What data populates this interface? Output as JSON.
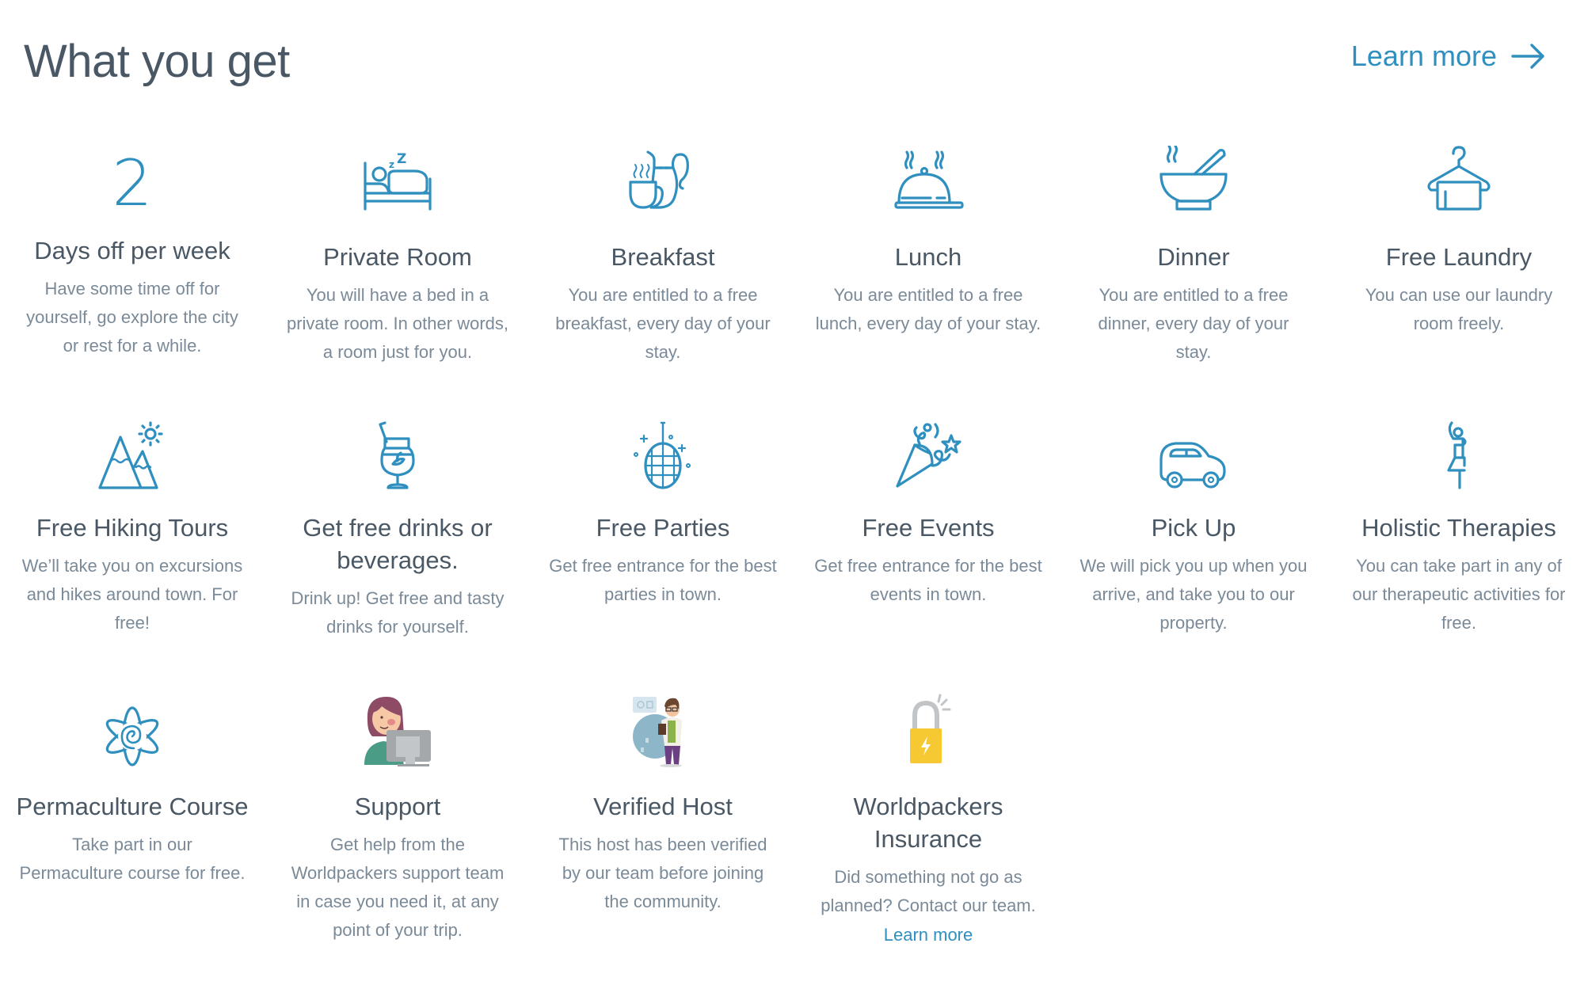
{
  "header": {
    "title": "What you get",
    "learn_more_label": "Learn more",
    "learn_more_icon": "arrow-right-icon"
  },
  "colors": {
    "accent": "#2f8fbf",
    "title_text": "#4a5865",
    "body_text": "#7a8a98",
    "insurance_lock": "#f6c933"
  },
  "benefits": [
    {
      "icon": "number",
      "number": "2",
      "title": "Days off per week",
      "description": "Have some time off for yourself, go explore the city or rest for a while."
    },
    {
      "icon": "bed-icon",
      "title": "Private Room",
      "description": "You will have a bed in a private room. In other words, a room just for you."
    },
    {
      "icon": "breakfast-icon",
      "title": "Breakfast",
      "description": "You are entitled to a free breakfast, every day of your stay."
    },
    {
      "icon": "cloche-icon",
      "title": "Lunch",
      "description": "You are entitled to a free lunch, every day of your stay."
    },
    {
      "icon": "bowl-icon",
      "title": "Dinner",
      "description": "You are entitled to a free dinner, every day of your stay."
    },
    {
      "icon": "hanger-icon",
      "title": "Free Laundry",
      "description": "You can use our laundry room freely."
    },
    {
      "icon": "mountain-icon",
      "title": "Free Hiking Tours",
      "description": "We’ll take you on excursions and hikes around town. For free!"
    },
    {
      "icon": "cocktail-icon",
      "title": "Get free drinks or beverages.",
      "description": "Drink up! Get free and tasty drinks for yourself."
    },
    {
      "icon": "disco-ball-icon",
      "title": "Free Parties",
      "description": "Get free entrance for the best parties in town."
    },
    {
      "icon": "party-popper-icon",
      "title": "Free Events",
      "description": "Get free entrance for the best events in town."
    },
    {
      "icon": "car-icon",
      "title": "Pick Up",
      "description": "We will pick you up when you arrive, and take you to our property."
    },
    {
      "icon": "yoga-icon",
      "title": "Holistic Therapies",
      "description": "You can take part in any of our therapeutic activities for free."
    },
    {
      "icon": "flower-spiral-icon",
      "title": "Permaculture Course",
      "description": "Take part in our Permaculture course for free."
    },
    {
      "icon": "support-agent-illustration",
      "title": "Support",
      "description": "Get help from the Worldpackers support team in case you need it, at any point of your trip."
    },
    {
      "icon": "verified-host-illustration",
      "title": "Verified Host",
      "description": "This host has been verified by our team before joining the community."
    },
    {
      "icon": "padlock-icon",
      "title": "Worldpackers Insurance",
      "description": "Did something not go as planned? Contact our team.",
      "link_label": "Learn more"
    }
  ]
}
